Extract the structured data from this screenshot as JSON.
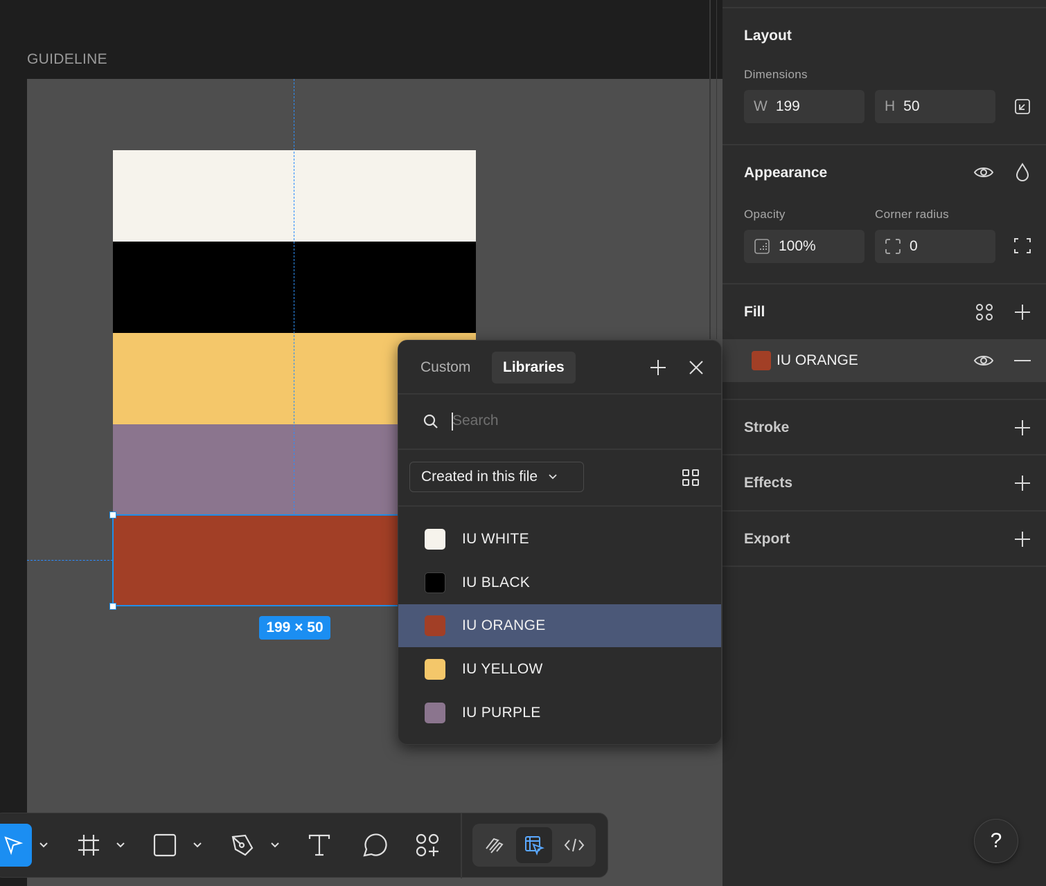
{
  "canvas": {
    "frame_label": "GUIDELINE",
    "size_badge": "199 × 50",
    "bands": [
      {
        "name": "IU WHITE",
        "color": "#f6f3ec"
      },
      {
        "name": "IU BLACK",
        "color": "#000000"
      },
      {
        "name": "IU YELLOW",
        "color": "#f4c76a"
      },
      {
        "name": "IU PURPLE",
        "color": "#8b758e"
      },
      {
        "name": "IU ORANGE",
        "color": "#a23f26"
      }
    ]
  },
  "panel": {
    "layout": {
      "title": "Layout",
      "dimensions_label": "Dimensions",
      "w_prefix": "W",
      "w_value": "199",
      "h_prefix": "H",
      "h_value": "50"
    },
    "appearance": {
      "title": "Appearance",
      "opacity_label": "Opacity",
      "opacity_value": "100%",
      "corner_radius_label": "Corner radius",
      "corner_radius_value": "0"
    },
    "fill": {
      "title": "Fill",
      "item_name": "IU ORANGE",
      "item_color": "#a23f26"
    },
    "stroke_title": "Stroke",
    "effects_title": "Effects",
    "export_title": "Export"
  },
  "popup": {
    "tabs": [
      "Custom",
      "Libraries"
    ],
    "active_tab": "Libraries",
    "search_placeholder": "Search",
    "dropdown_value": "Created in this file",
    "styles": [
      {
        "name": "IU WHITE",
        "color": "#f6f3ec",
        "selected": false
      },
      {
        "name": "IU BLACK",
        "color": "#000000",
        "selected": false
      },
      {
        "name": "IU ORANGE",
        "color": "#a23f26",
        "selected": true
      },
      {
        "name": "IU YELLOW",
        "color": "#f4c76a",
        "selected": false
      },
      {
        "name": "IU PURPLE",
        "color": "#8b758e",
        "selected": false
      }
    ]
  },
  "toolbar": {
    "tools": [
      "move-tool",
      "frame-tool",
      "rectangle-tool",
      "pen-tool",
      "text-tool",
      "comment-tool",
      "actions-tool"
    ],
    "modes": [
      "draw-mode",
      "design-mode",
      "dev-mode"
    ],
    "active_mode": "design-mode"
  },
  "help_label": "?"
}
